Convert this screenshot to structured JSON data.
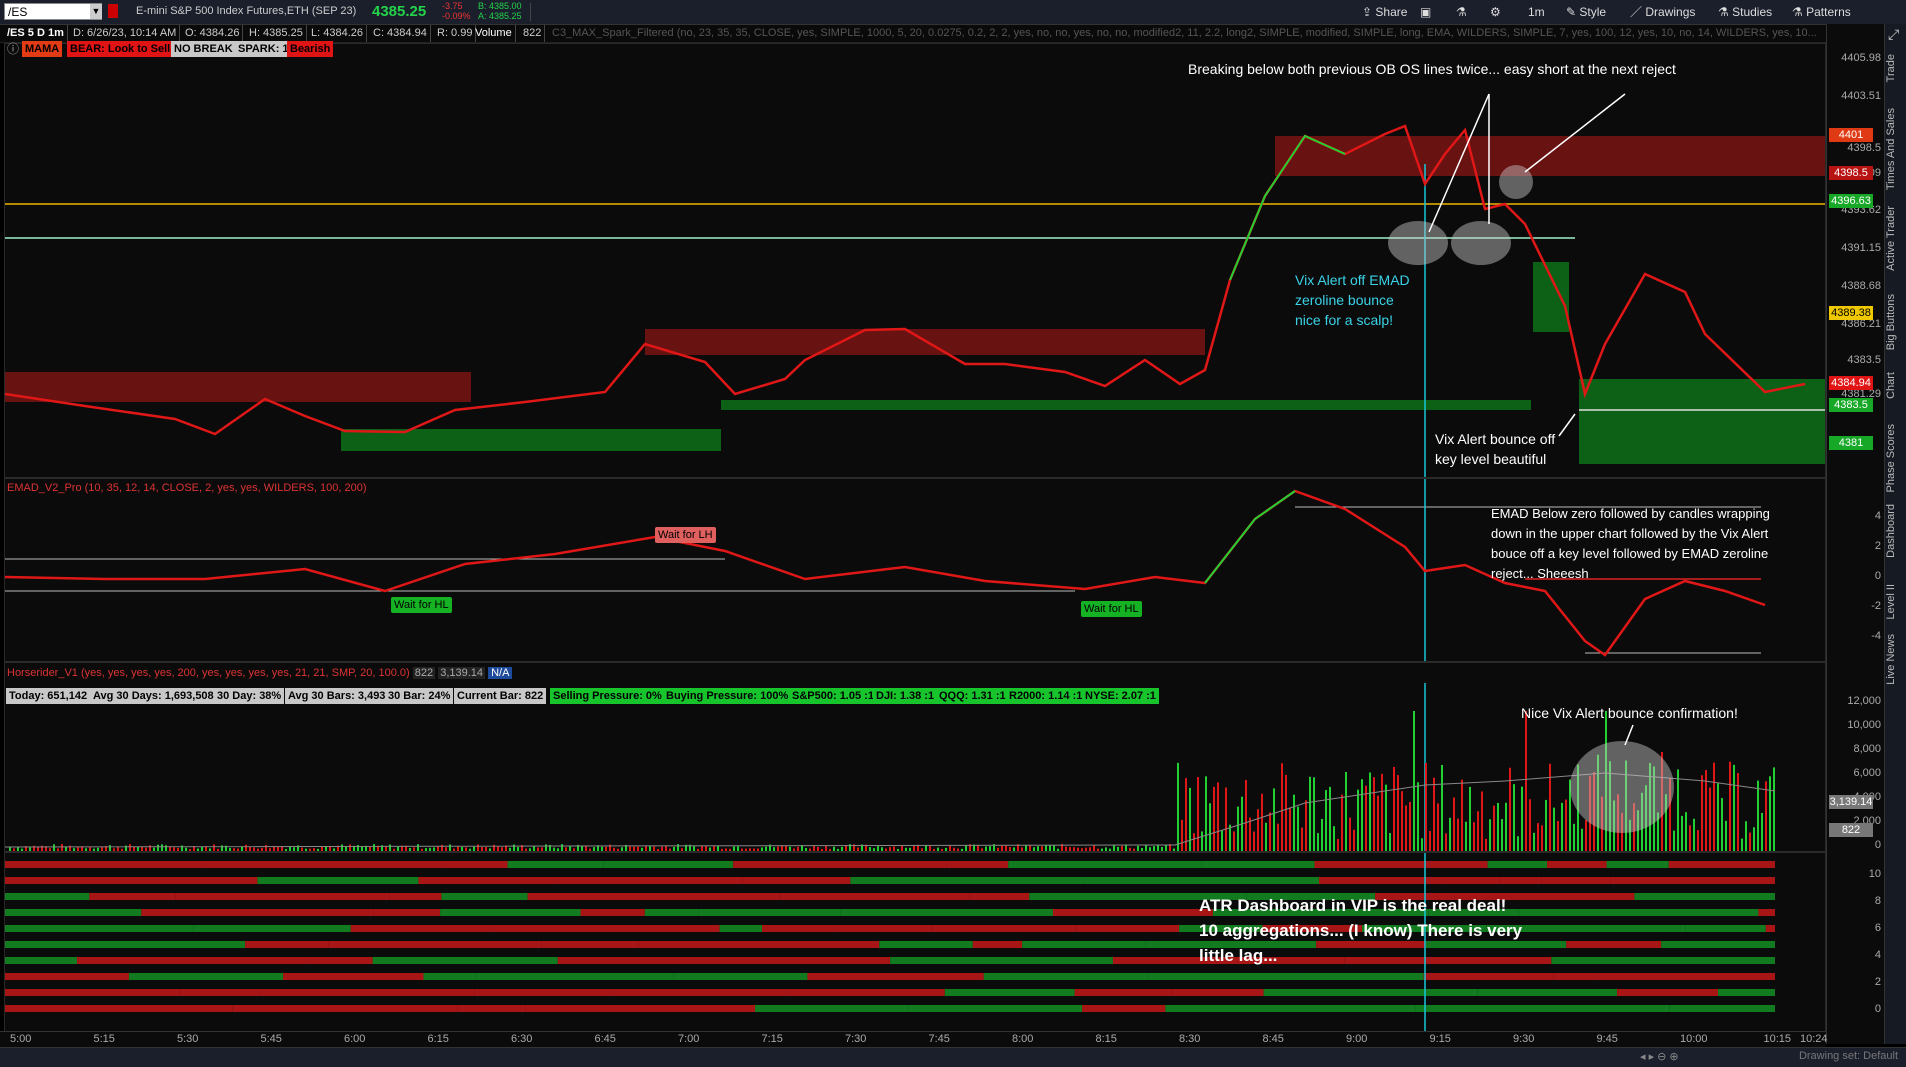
{
  "toolbar": {
    "symbol": "/ES",
    "description": "E-mini S&P 500 Index Futures,ETH (SEP 23)",
    "last_price": "4385.25",
    "change": "-3.75",
    "change_pct": "-0.09%",
    "bid": "B: 4385.00",
    "ask": "A: 4385.25",
    "share": "Share",
    "timeframe": "1m",
    "style": "Style",
    "drawings": "Drawings",
    "studies": "Studies",
    "patterns": "Patterns"
  },
  "infobar": {
    "chart_id": "/ES 5 D 1m",
    "date": "D: 6/26/23, 10:14 AM",
    "open": "O: 4384.26",
    "high": "H: 4385.25",
    "low": "L: 4384.26",
    "close": "C: 4384.94",
    "range": "R: 0.99",
    "volume_label": "Volume",
    "volume": "822",
    "study_params": "C3_MAX_Spark_Filtered (no, 23, 35, 35, CLOSE, yes, SIMPLE, 1000, 5, 20, 0.0275, 0.2, 2, 2, yes, no, no, yes, no, no, modified2, 11, 2.2, long2, SIMPLE, modified, SIMPLE, long, EMA, WILDERS, SIMPLE, 7, yes, 100, 12, yes, 10, no, 14, WILDERS, yes, 10..."
  },
  "status_tags": {
    "mama": "MAMA",
    "bear": "BEAR: Look to Sell",
    "no_break": "NO BREAK",
    "spark": "SPARK: 1",
    "bearish": "Bearish"
  },
  "annotations": {
    "breaking": "Breaking below both previous OB OS lines twice... easy short at the next reject",
    "vix_emad_1": "Vix Alert off EMAD",
    "vix_emad_2": "zeroline bounce",
    "vix_emad_3": "nice for a scalp!",
    "vix_key_1": "Vix Alert bounce off",
    "vix_key_2": "key level beautiful",
    "emad_1": "EMAD Below zero followed by candles wrapping",
    "emad_2": "down in the upper chart followed by the Vix Alert",
    "emad_3": "bouce off a key level followed by EMAD zeroline",
    "emad_4": "reject... Sheeesh",
    "nice_vix": "Nice Vix Alert bounce confirmation!",
    "atr_1": "ATR Dashboard in VIP is the real deal!",
    "atr_2": "10 aggregations... (I know) There is very",
    "atr_3": "little lag..."
  },
  "emad": {
    "title": "EMAD_V2_Pro (10, 35, 12, 14, CLOSE, 2, yes, yes, WILDERS, 100, 200)",
    "wait_lh": "Wait for LH",
    "wait_hl_1": "Wait for HL",
    "wait_hl_2": "Wait for HL",
    "axis": [
      "4",
      "2",
      "0",
      "-2",
      "-4"
    ]
  },
  "volume": {
    "title": "Horserider_V1 (yes, yes, yes, yes, 200, yes, yes, yes, yes, 21, 21, SMP, 20, 100.0)",
    "v1": "822",
    "v2": "3,139.14",
    "na": "N/A",
    "today": "Today: 651,142",
    "avg30d": "Avg 30 Days: 1,693,508",
    "day30": "30 Day: 38%",
    "avg30b": "Avg 30 Bars: 3,493",
    "bar30": "30 Bar: 24%",
    "current": "Current Bar: 822",
    "selling": "Selling Pressure: 0%",
    "buying": "Buying Pressure: 100%",
    "sp500": "S&P500: 1.05 :1",
    "dji": "DJI: 1.38 :1",
    "qqq": "QQQ: 1.31 :1",
    "r2000": "R2000: 1.14 :1",
    "nyse": "NYSE: 2.07 :1",
    "axis": [
      "12,000",
      "10,000",
      "8,000",
      "6,000",
      "4,000",
      "2,000",
      "0"
    ],
    "tag_avg": "3,139.14",
    "tag_cur": "822"
  },
  "dash_axis": [
    "10",
    "8",
    "6",
    "4",
    "2",
    "0"
  ],
  "price_axis": [
    "4405.98",
    "4403.51",
    "4398.5",
    "4396.09",
    "4393.62",
    "4391.15",
    "4388.68",
    "4386.21",
    "4383.5",
    "4381.29"
  ],
  "price_tags": {
    "r1": "4401",
    "r2": "4398.5",
    "y1": "4396.63",
    "y2": "4389.38",
    "cur": "4384.94",
    "g1": "4383.5",
    "g2": "4381"
  },
  "time_axis": [
    "5:00",
    "5:15",
    "5:30",
    "5:45",
    "6:00",
    "6:15",
    "6:30",
    "6:45",
    "7:00",
    "7:15",
    "7:30",
    "7:45",
    "8:00",
    "8:15",
    "8:30",
    "8:45",
    "9:00",
    "9:15",
    "9:30",
    "9:45",
    "10:00",
    "10:15",
    "10:24"
  ],
  "right_tabs": [
    "Trade",
    "Times And Sales",
    "Active Trader",
    "Big Buttons",
    "Chart",
    "Phase Scores",
    "Dashboard",
    "Level II",
    "Live News"
  ],
  "bottom": {
    "drawing_set": "Drawing set: Default"
  }
}
